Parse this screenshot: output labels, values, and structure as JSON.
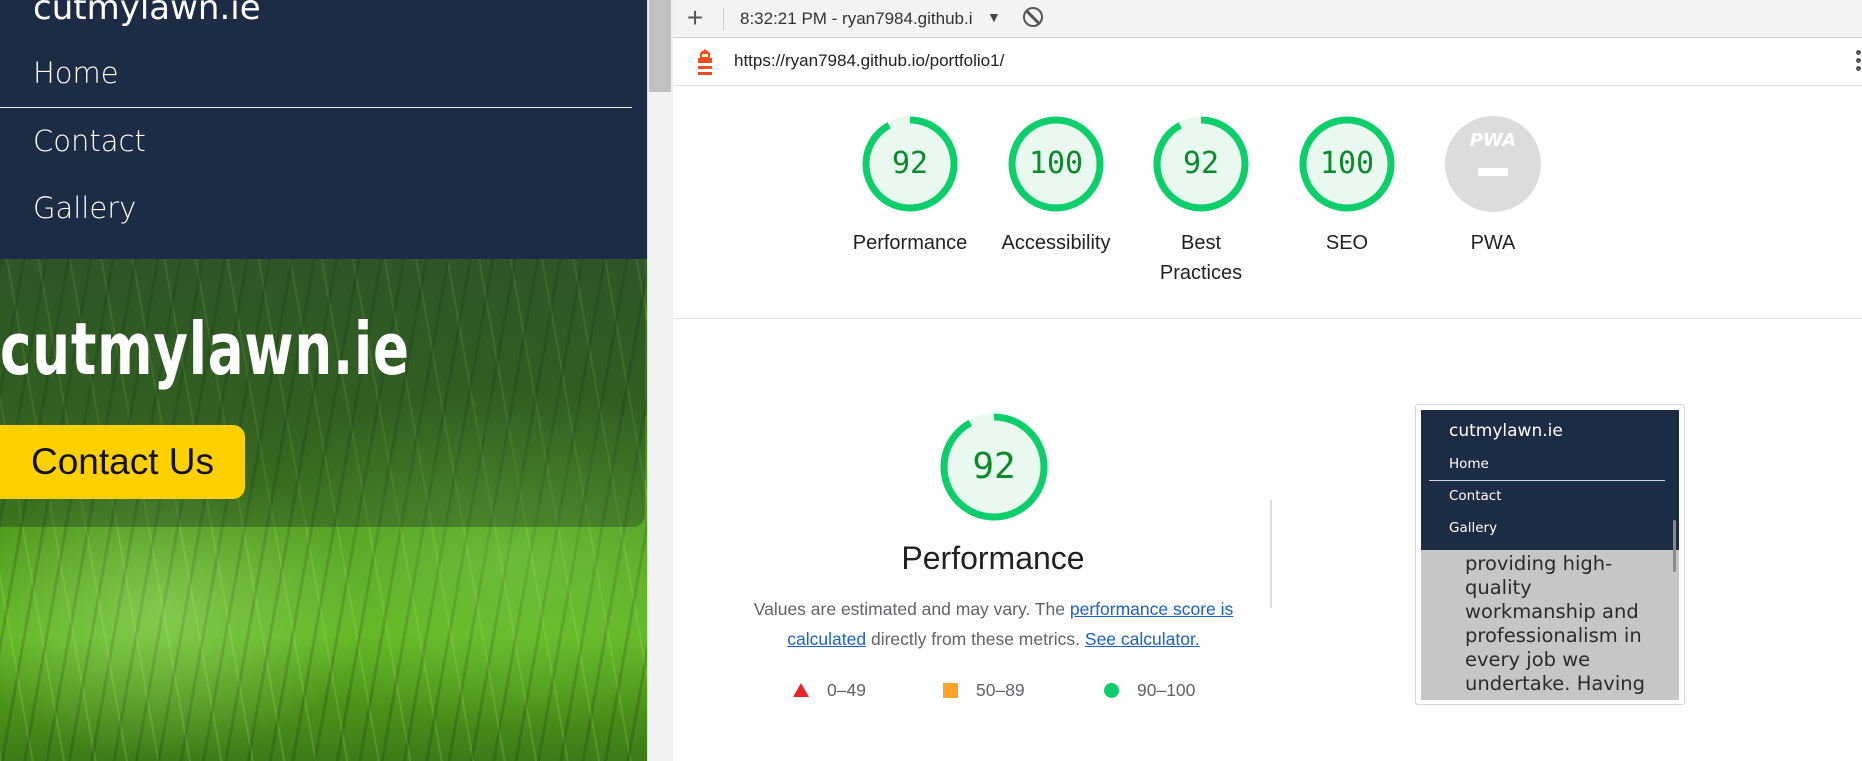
{
  "site": {
    "brand": "cutmylawn.ie",
    "nav": [
      "Home",
      "Contact",
      "Gallery"
    ],
    "hero_title": "cutmylawn.ie",
    "cta_label": "Contact Us"
  },
  "toolbar": {
    "new_label": "+",
    "report_label": "8:32:21 PM - ryan7984.github.i",
    "caret": "▼"
  },
  "urlbar": {
    "url": "https://ryan7984.github.io/portfolio1/"
  },
  "categories": [
    {
      "label": "Performance",
      "score": 92
    },
    {
      "label": "Accessibility",
      "score": 100
    },
    {
      "label": "Best Practices",
      "score": 92
    },
    {
      "label": "SEO",
      "score": 100
    },
    {
      "label": "PWA",
      "badge_text": "PWA"
    }
  ],
  "performance": {
    "score": 92,
    "title": "Performance",
    "desc_prefix": "Values are estimated and may vary. The ",
    "desc_link1": "performance score is calculated",
    "desc_middle": " directly from these metrics. ",
    "desc_link2": "See calculator.",
    "legend": {
      "fail": "0–49",
      "average": "50–89",
      "pass": "90–100"
    }
  },
  "thumbnail": {
    "brand": "cutmylawn.ie",
    "nav": [
      "Home",
      "Contact",
      "Gallery"
    ],
    "body_text": "service while providing high-quality workmanship and professionalism in every job we undertake. Having"
  },
  "colors": {
    "pass": "#0cce6b",
    "pass_text": "#0a8a2a",
    "average": "#ffa32a",
    "fail": "#e8242a",
    "nav_bg": "#1c2c45",
    "cta": "#ffd000",
    "link": "#1a5fd6"
  }
}
